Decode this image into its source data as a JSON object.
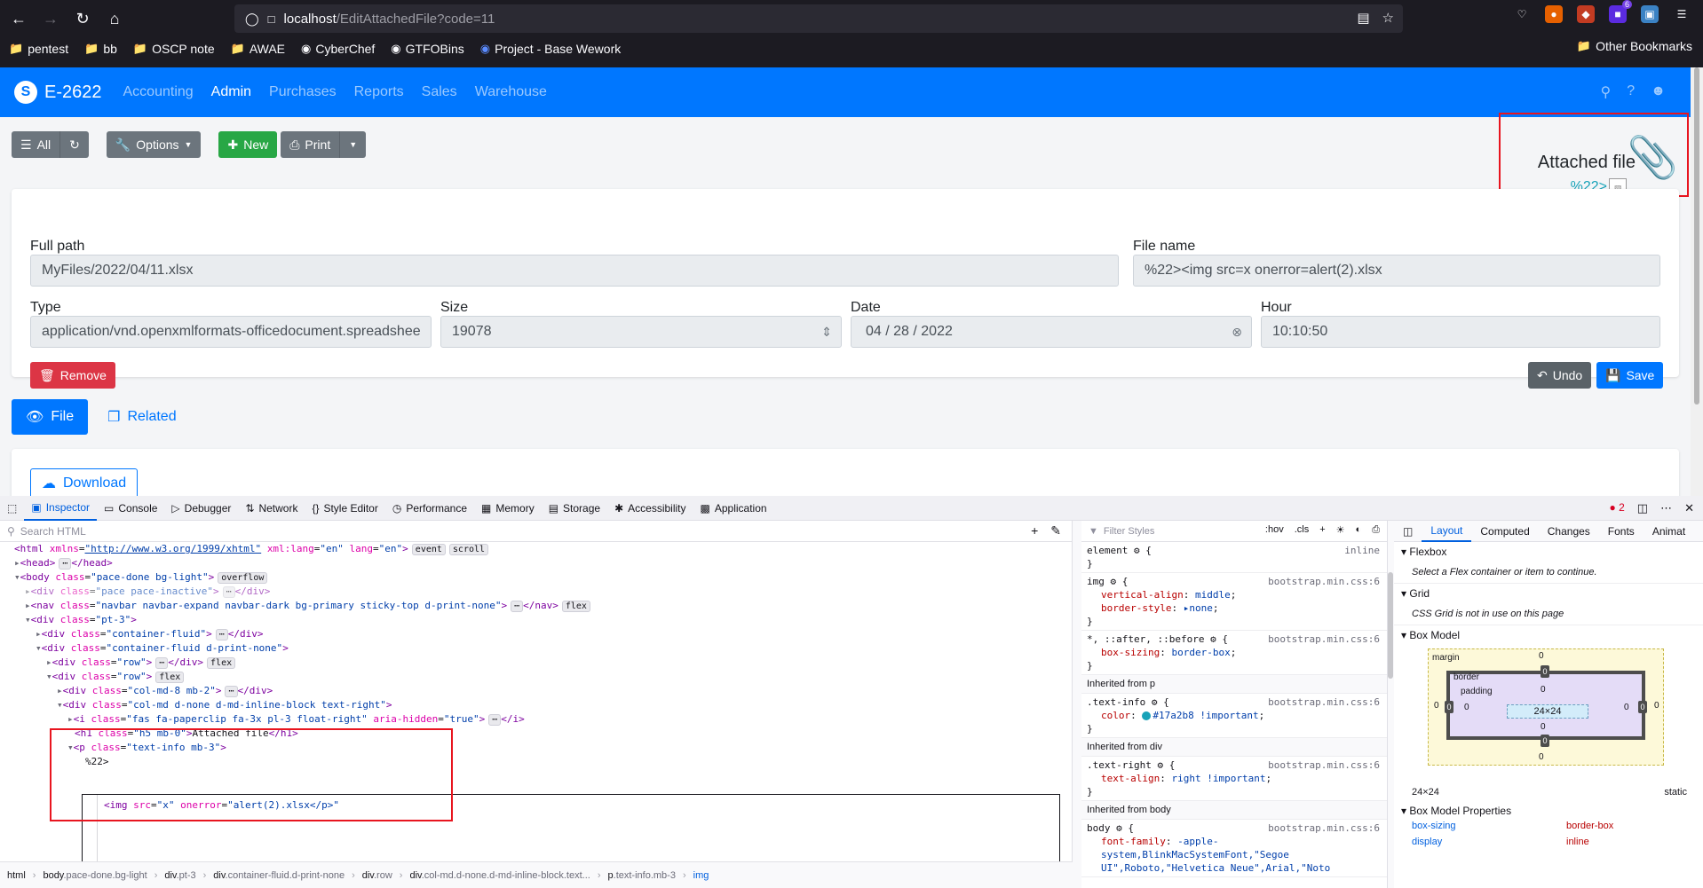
{
  "browser": {
    "url_host": "localhost",
    "url_path": "/EditAttachedFile?code=11",
    "ext_badge": "6",
    "bookmarks": [
      "pentest",
      "bb",
      "OSCP note",
      "AWAE",
      "CyberChef",
      "GTFOBins",
      "Project - Base Wework"
    ],
    "other_bookmarks": "Other Bookmarks"
  },
  "navbar": {
    "brand": "E-2622",
    "menu": [
      "Accounting",
      "Admin",
      "Purchases",
      "Reports",
      "Sales",
      "Warehouse"
    ],
    "active_menu": "Admin"
  },
  "toolbar": {
    "all_label": "All",
    "options_label": "Options",
    "new_label": "New",
    "print_label": "Print"
  },
  "attached": {
    "title": "Attached file",
    "value": "%22>"
  },
  "form": {
    "full_path_label": "Full path",
    "full_path": "MyFiles/2022/04/11.xlsx",
    "file_name_label": "File name",
    "file_name": "%22><img src=x onerror=alert(2).xlsx",
    "type_label": "Type",
    "type": "application/vnd.openxmlformats-officedocument.spreadshee",
    "size_label": "Size",
    "size": "19078",
    "date_label": "Date",
    "date": "04 / 28 / 2022",
    "hour_label": "Hour",
    "hour": "10:10:50",
    "remove_label": "Remove",
    "undo_label": "Undo",
    "save_label": "Save"
  },
  "tabs": {
    "file_label": "File",
    "related_label": "Related",
    "download_label": "Download"
  },
  "devtools": {
    "tabs": [
      "Inspector",
      "Console",
      "Debugger",
      "Network",
      "Style Editor",
      "Performance",
      "Memory",
      "Storage",
      "Accessibility",
      "Application"
    ],
    "error_count": "2",
    "search_placeholder": "Search HTML",
    "filter_placeholder": "Filter Styles",
    "hov": ":hov",
    "cls": ".cls",
    "breadcrumbs": [
      {
        "tag": "html",
        "cls": ""
      },
      {
        "tag": "body",
        "cls": ".pace-done.bg-light"
      },
      {
        "tag": "div",
        "cls": ".pt-3"
      },
      {
        "tag": "div",
        "cls": ".container-fluid.d-print-none"
      },
      {
        "tag": "div",
        "cls": ".row"
      },
      {
        "tag": "div",
        "cls": ".col-md.d-none.d-md-inline-block.text..."
      },
      {
        "tag": "p",
        "cls": ".text-info.mb-3"
      },
      {
        "tag": "img",
        "cls": ""
      }
    ],
    "layout_tabs": [
      "Layout",
      "Computed",
      "Changes",
      "Fonts",
      "Animat"
    ],
    "flexbox_title": "Flexbox",
    "flexbox_note": "Select a Flex container or item to continue.",
    "grid_title": "Grid",
    "grid_note": "CSS Grid is not in use on this page",
    "boxmodel_title": "Box Model",
    "bm_margin": "margin",
    "bm_border": "border",
    "bm_padding": "padding",
    "bm_zero": "0",
    "bm_content": "24×24",
    "dims": "24×24",
    "position": "static",
    "bm_props_title": "Box Model Properties",
    "bm_props": [
      {
        "k": "box-sizing",
        "v": "border-box"
      },
      {
        "k": "display",
        "v": "inline"
      }
    ]
  }
}
